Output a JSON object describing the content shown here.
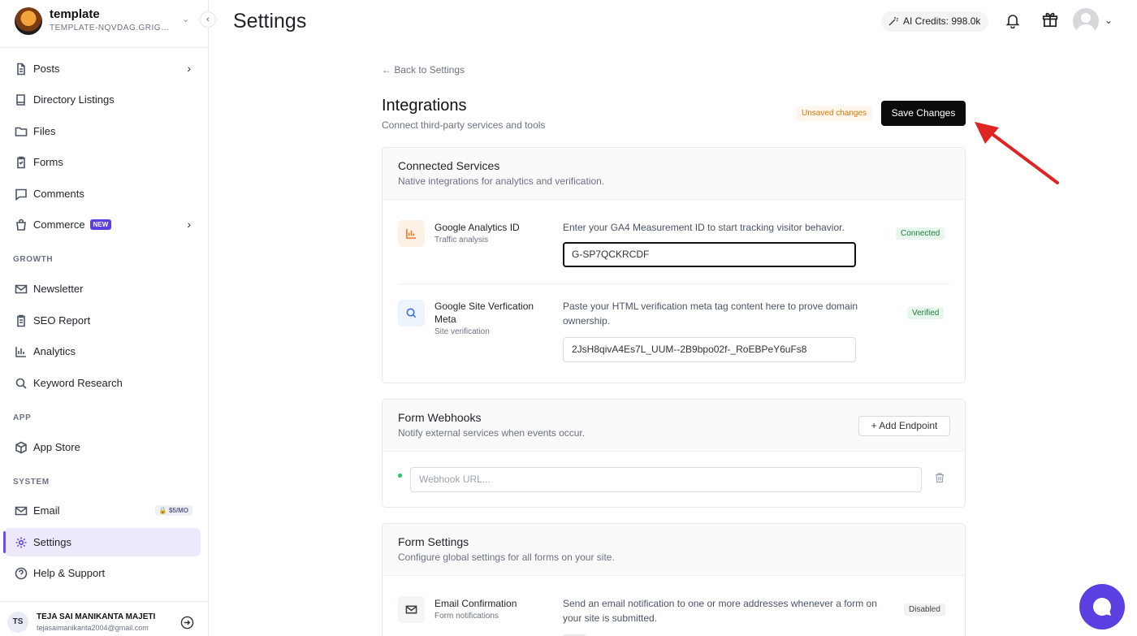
{
  "workspace": {
    "name": "template",
    "slug": "TEMPLATE-NQVDAG.GRIGOR..."
  },
  "sidebar": {
    "items": [
      {
        "label": "Posts",
        "icon": "document-icon"
      },
      {
        "label": "Directory Listings",
        "icon": "book-icon"
      },
      {
        "label": "Files",
        "icon": "folder-icon"
      },
      {
        "label": "Forms",
        "icon": "clipboard-icon"
      },
      {
        "label": "Comments",
        "icon": "chat-icon"
      },
      {
        "label": "Commerce",
        "icon": "bag-icon",
        "badge": "NEW"
      },
      {
        "label": "Newsletter",
        "icon": "mail-icon"
      },
      {
        "label": "SEO Report",
        "icon": "clipboard-icon"
      },
      {
        "label": "Analytics",
        "icon": "bar-chart-icon"
      },
      {
        "label": "Keyword Research",
        "icon": "search-icon"
      },
      {
        "label": "App Store",
        "icon": "cube-icon"
      },
      {
        "label": "Email",
        "icon": "mail-icon",
        "badge": "$5/MO"
      },
      {
        "label": "Settings",
        "icon": "gear-icon",
        "active": true
      },
      {
        "label": "Help & Support",
        "icon": "help-icon"
      }
    ],
    "sections": {
      "growth": "GROWTH",
      "app": "APP",
      "system": "SYSTEM"
    },
    "user": {
      "initials": "TS",
      "name": "TEJA SAI MANIKANTA MAJETI",
      "email": "tejasaimanikanta2004@gmail.com"
    }
  },
  "header": {
    "title": "Settings",
    "credits": "AI Credits: 998.0k"
  },
  "main": {
    "back": "← Back to Settings",
    "title": "Integrations",
    "subtitle": "Connect third-party services and tools",
    "unsaved": "Unsaved changes",
    "save": "Save Changes",
    "connected": {
      "title": "Connected Services",
      "subtitle": "Native integrations for analytics and verification.",
      "ga": {
        "title": "Google Analytics ID",
        "sub": "Traffic analysis",
        "desc": "Enter your GA4 Measurement ID to start tracking visitor behavior.",
        "value": "G-SP7QCKRCDF",
        "status": "Connected"
      },
      "gsv": {
        "title": "Google Site Verfication Meta",
        "sub": "Site verification",
        "desc": "Paste your HTML verification meta tag content here to prove domain ownership.",
        "value": "2JsH8qivA4Es7L_UUM--2B9bpo02f-_RoEBPeY6uFs8",
        "status": "Verified"
      }
    },
    "webhooks": {
      "title": "Form Webhooks",
      "subtitle": "Notify external services when events occur.",
      "add": "+ Add Endpoint",
      "placeholder": "Webhook URL..."
    },
    "formsettings": {
      "title": "Form Settings",
      "subtitle": "Configure global settings for all forms on your site.",
      "email": {
        "title": "Email Confirmation",
        "sub": "Form notifications",
        "desc": "Send an email notification to one or more addresses whenever a form on your site is submitted.",
        "status": "Disabled"
      }
    }
  },
  "colors": {
    "accent": "#5b3fe0",
    "active_bg": "#ede9fb",
    "connected": "#1f7a42",
    "unsaved": "#d97706",
    "arrow": "#e02424"
  }
}
